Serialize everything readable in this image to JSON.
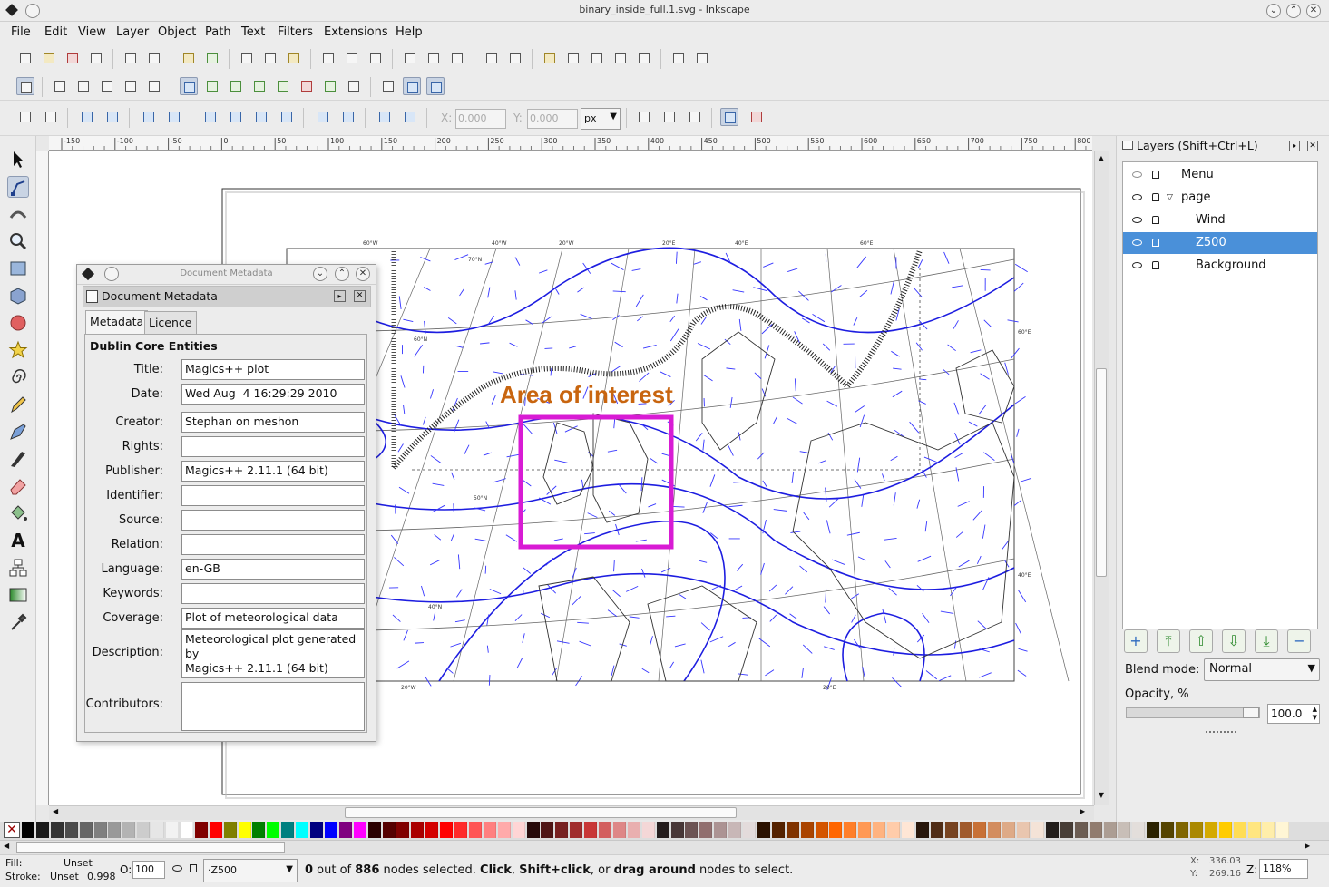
{
  "window": {
    "title": "binary_inside_full.1.svg - Inkscape"
  },
  "menus": [
    "File",
    "Edit",
    "View",
    "Layer",
    "Object",
    "Path",
    "Text",
    "Filters",
    "Extensions",
    "Help"
  ],
  "node_toolbar": {
    "x_label": "X:",
    "x_value": "0.000",
    "y_label": "Y:",
    "y_value": "0.000",
    "unit": "px"
  },
  "ruler_h": [
    "-150",
    "-100",
    "-50",
    "0",
    "50",
    "100",
    "150",
    "200",
    "250",
    "300",
    "350",
    "400",
    "450",
    "500",
    "550",
    "600",
    "650",
    "700",
    "750",
    "800"
  ],
  "map": {
    "annotation": "Area of interest",
    "lat_labels": [
      "60°W",
      "40°W",
      "20°W",
      "20°E",
      "40°E",
      "60°E",
      "60°E",
      "40°E",
      "70°N",
      "60°N",
      "50°N",
      "40°N",
      "20°W",
      "20°E"
    ]
  },
  "dialog": {
    "caption": "Document Metadata",
    "subtitle": "Document Metadata",
    "tabs": [
      "Metadata",
      "Licence"
    ],
    "section": "Dublin Core Entities",
    "fields": [
      {
        "label": "Title:",
        "value": "Magics++ plot"
      },
      {
        "label": "Date:",
        "value": "Wed Aug  4 16:29:29 2010"
      },
      {
        "label": "Creator:",
        "value": "Stephan on meshon"
      },
      {
        "label": "Rights:",
        "value": ""
      },
      {
        "label": "Publisher:",
        "value": "Magics++ 2.11.1 (64 bit)"
      },
      {
        "label": "Identifier:",
        "value": ""
      },
      {
        "label": "Source:",
        "value": ""
      },
      {
        "label": "Relation:",
        "value": ""
      },
      {
        "label": "Language:",
        "value": "en-GB"
      },
      {
        "label": "Keywords:",
        "value": ""
      },
      {
        "label": "Coverage:",
        "value": "Plot of meteorological data"
      }
    ],
    "description_label": "Description:",
    "description": "Meteorological plot generated by\nMagics++ 2.11.1 (64 bit)",
    "contributors_label": "Contributors:"
  },
  "layers": {
    "title": "Layers (Shift+Ctrl+L)",
    "items": [
      "Menu",
      "page",
      "Wind",
      "Z500",
      "Background"
    ],
    "selected": "Z500",
    "blend_label": "Blend mode:",
    "blend_value": "Normal",
    "opacity_label": "Opacity, %",
    "opacity_value": "100.0"
  },
  "palette": [
    "#000000",
    "#1a1a1a",
    "#333333",
    "#4d4d4d",
    "#666666",
    "#808080",
    "#999999",
    "#b3b3b3",
    "#cccccc",
    "#e6e6e6",
    "#f2f2f2",
    "#ffffff",
    "#800000",
    "#ff0000",
    "#808000",
    "#ffff00",
    "#008000",
    "#00ff00",
    "#008080",
    "#00ffff",
    "#000080",
    "#0000ff",
    "#800080",
    "#ff00ff",
    "#2b0000",
    "#550000",
    "#800000",
    "#aa0000",
    "#d40000",
    "#ff0000",
    "#ff2a2a",
    "#ff5555",
    "#ff8080",
    "#ffaaaa",
    "#ffd5d5",
    "#280b0b",
    "#501616",
    "#782121",
    "#a02c2c",
    "#c83737",
    "#d35f5f",
    "#de8787",
    "#e9afaf",
    "#f4d7d7",
    "#241c1c",
    "#483737",
    "#6c5353",
    "#916f6f",
    "#ac9393",
    "#c8b7b7",
    "#e3dbdb",
    "#2b1100",
    "#552200",
    "#803300",
    "#aa4400",
    "#d45500",
    "#ff6600",
    "#ff7f2a",
    "#ff9955",
    "#ffb380",
    "#ffccaa",
    "#ffe6d5",
    "#28170b",
    "#502d16",
    "#784421",
    "#a05a2c",
    "#c87137",
    "#d38d5f",
    "#deaa87",
    "#e9c6af",
    "#f4e3d7",
    "#241f1c",
    "#483e37",
    "#6c5d53",
    "#917c6f",
    "#ac9d93",
    "#c8beb7",
    "#e3dedb",
    "#2b2200",
    "#554400",
    "#806600",
    "#aa8800",
    "#d4aa00",
    "#ffcc00",
    "#ffdd55",
    "#ffe680",
    "#ffeeaa",
    "#fff6d5"
  ],
  "status": {
    "fill_label": "Fill:",
    "fill_value": "Unset",
    "stroke_label": "Stroke:",
    "stroke_value": "Unset",
    "stroke_width": "0.998",
    "opacity_label": "O:",
    "opacity_value": "100",
    "layer": "·Z500",
    "msg_a": "0",
    "msg_b": " out of ",
    "msg_c": "886",
    "msg_d": " nodes selected. ",
    "msg_e": "Click",
    "msg_f": ", ",
    "msg_g": "Shift+click",
    "msg_h": ", or ",
    "msg_i": "drag around",
    "msg_j": " nodes to select.",
    "x_label": "X:",
    "x_value": "336.03",
    "y_label": "Y:",
    "y_value": "269.16",
    "zoom_label": "Z:",
    "zoom_value": "118%"
  }
}
